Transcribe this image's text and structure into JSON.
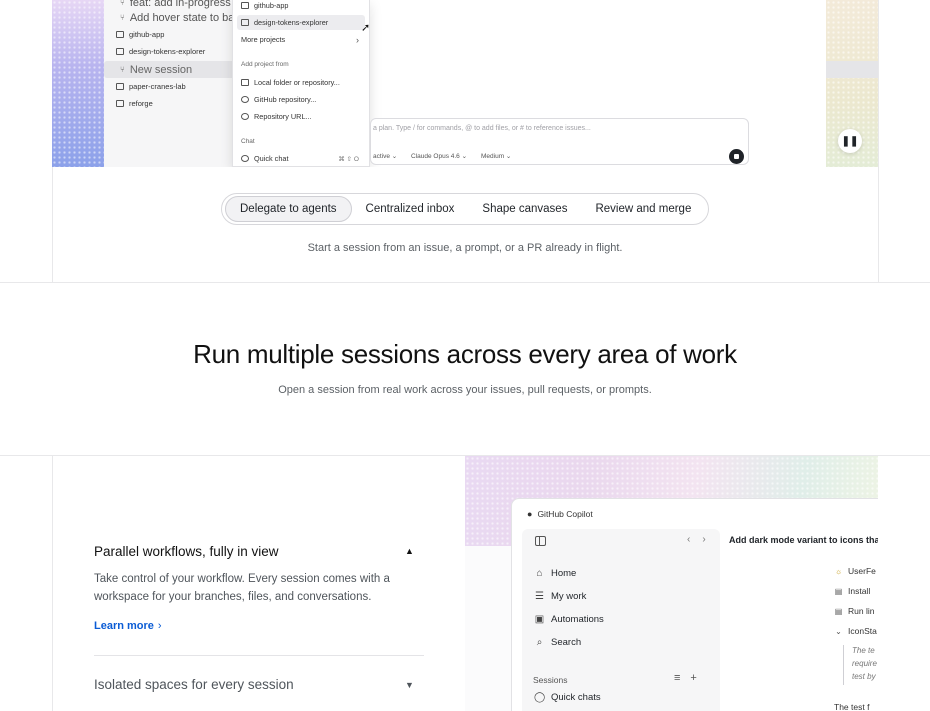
{
  "demo": {
    "sidebar_items": [
      {
        "label": "feat: add in-progress state ti",
        "kind": "branch"
      },
      {
        "label": "Add hover state to badge",
        "kind": "branch"
      },
      {
        "label": "github-app",
        "kind": "folder"
      },
      {
        "label": "design-tokens-explorer",
        "kind": "folder"
      },
      {
        "label": "New session",
        "kind": "branch"
      },
      {
        "label": "paper-cranes-lab",
        "kind": "folder"
      },
      {
        "label": "reforge",
        "kind": "folder"
      }
    ],
    "dropdown": {
      "items_top": [
        "github-app",
        "design-tokens-explorer"
      ],
      "more_projects": "More projects",
      "add_project_from": "Add project from",
      "add_items": [
        "Local folder or repository...",
        "GitHub repository...",
        "Repository URL..."
      ],
      "chat_label": "Chat",
      "quick_chat": "Quick chat",
      "quick_chat_kbd": "⌘ ⇧ O"
    },
    "prompt": {
      "placeholder": "a plan. Type / for commands, @ to add files, or # to reference issues...",
      "mode": "active",
      "model": "Claude Opus 4.6",
      "effort": "Medium"
    }
  },
  "tabs": {
    "items": [
      "Delegate to agents",
      "Centralized inbox",
      "Shape canvases",
      "Review and merge"
    ],
    "caption": "Start a session from an issue, a prompt, or a PR already in flight."
  },
  "section": {
    "title": "Run multiple sessions across every area of work",
    "subtitle": "Open a session from real work across your issues, pull requests, or prompts."
  },
  "features": {
    "first": {
      "title": "Parallel workflows, fully in view",
      "description": "Take control of your workflow. Every session comes with a workspace for your branches, files, and conversations.",
      "link": "Learn more"
    },
    "second": {
      "title": "Isolated spaces for every session"
    }
  },
  "app_preview": {
    "window_title": "GitHub Copilot",
    "header": "Add dark mode variant to icons tha",
    "nav": [
      "Home",
      "My work",
      "Automations",
      "Search"
    ],
    "sessions_label": "Sessions",
    "quick_chats": "Quick chats",
    "right_items": [
      "UserFe",
      "Install",
      "Run lin",
      "IconSta"
    ],
    "italic_lines": [
      "The te",
      "require",
      "test by"
    ],
    "bottom_text": "The test f"
  }
}
